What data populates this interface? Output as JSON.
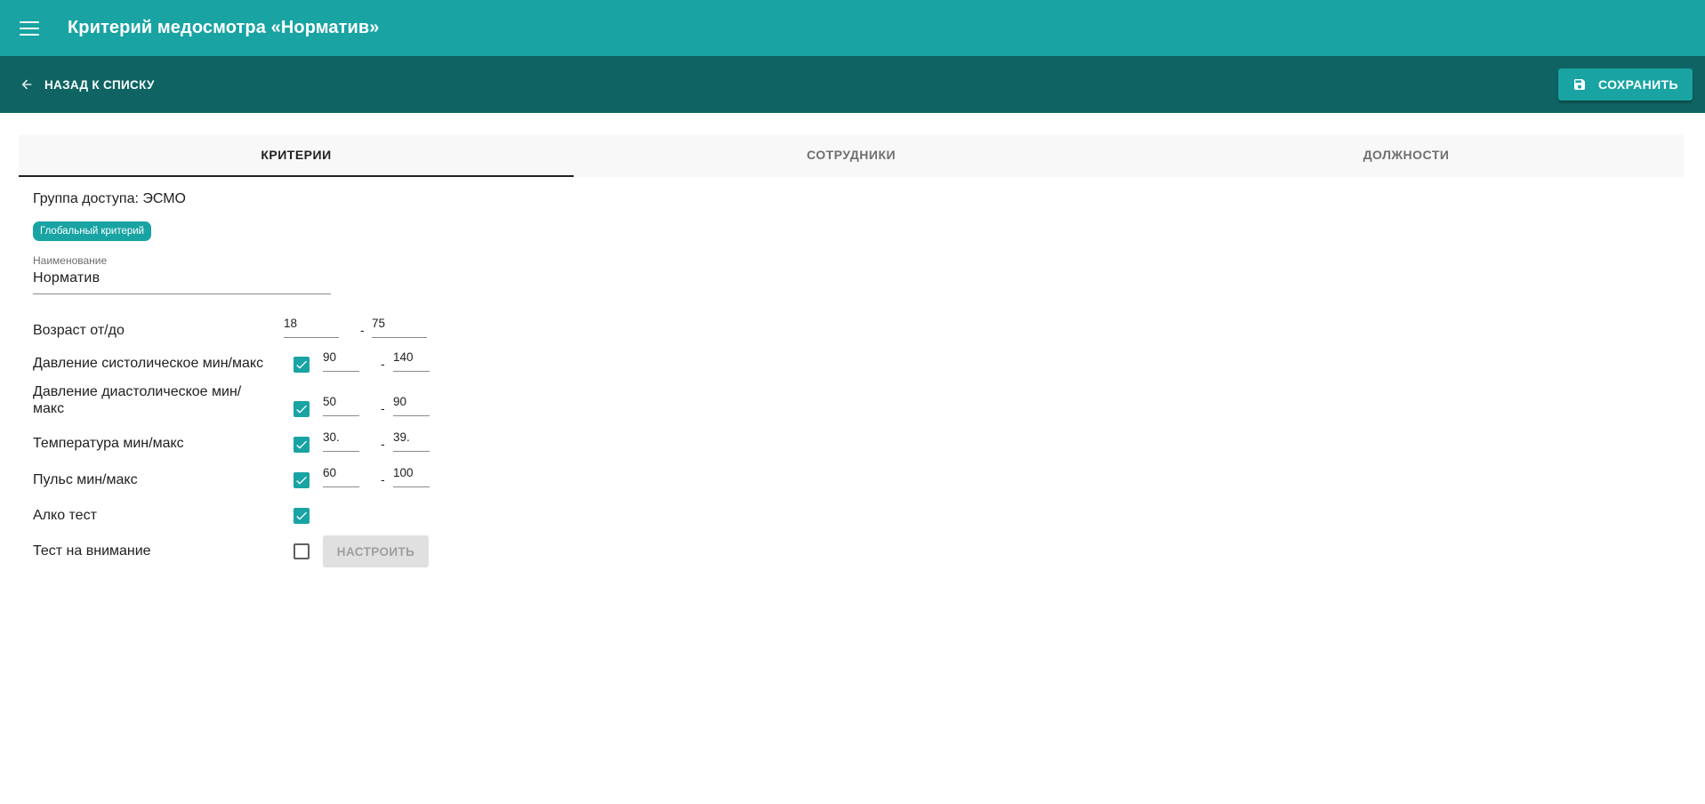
{
  "appbar": {
    "title": "Критерий медосмотра «Норматив»"
  },
  "toolbar": {
    "back_label": "НАЗАД К СПИСКУ",
    "save_label": "СОХРАНИТЬ"
  },
  "tabs": [
    {
      "label": "КРИТЕРИИ",
      "active": true
    },
    {
      "label": "СОТРУДНИКИ",
      "active": false
    },
    {
      "label": "ДОЛЖНОСТИ",
      "active": false
    }
  ],
  "form": {
    "group_access": "Группа доступа: ЭСМО",
    "chip": "Глобальный критерий",
    "name_label": "Наименование",
    "name_value": "Норматив",
    "age": {
      "label": "Возраст от/до",
      "min": "18",
      "max": "75"
    },
    "systolic": {
      "label": "Давление систолическое мин/макс",
      "checked": true,
      "min": "90",
      "max": "140"
    },
    "diastolic": {
      "label": "Давление диастолическое мин/макс",
      "checked": true,
      "min": "50",
      "max": "90"
    },
    "temperature": {
      "label": "Температура мин/макс",
      "checked": true,
      "min": "30.",
      "max": "39."
    },
    "pulse": {
      "label": "Пульс мин/макс",
      "checked": true,
      "min": "60",
      "max": "100"
    },
    "alco": {
      "label": "Алко тест",
      "checked": true
    },
    "attention": {
      "label": "Тест на внимание",
      "checked": false,
      "button_label": "НАСТРОИТЬ"
    },
    "dash": "-"
  },
  "colors": {
    "primary": "#19a3a3",
    "primary_dark": "#0f6463",
    "tab_bg": "#f8f8f8"
  }
}
